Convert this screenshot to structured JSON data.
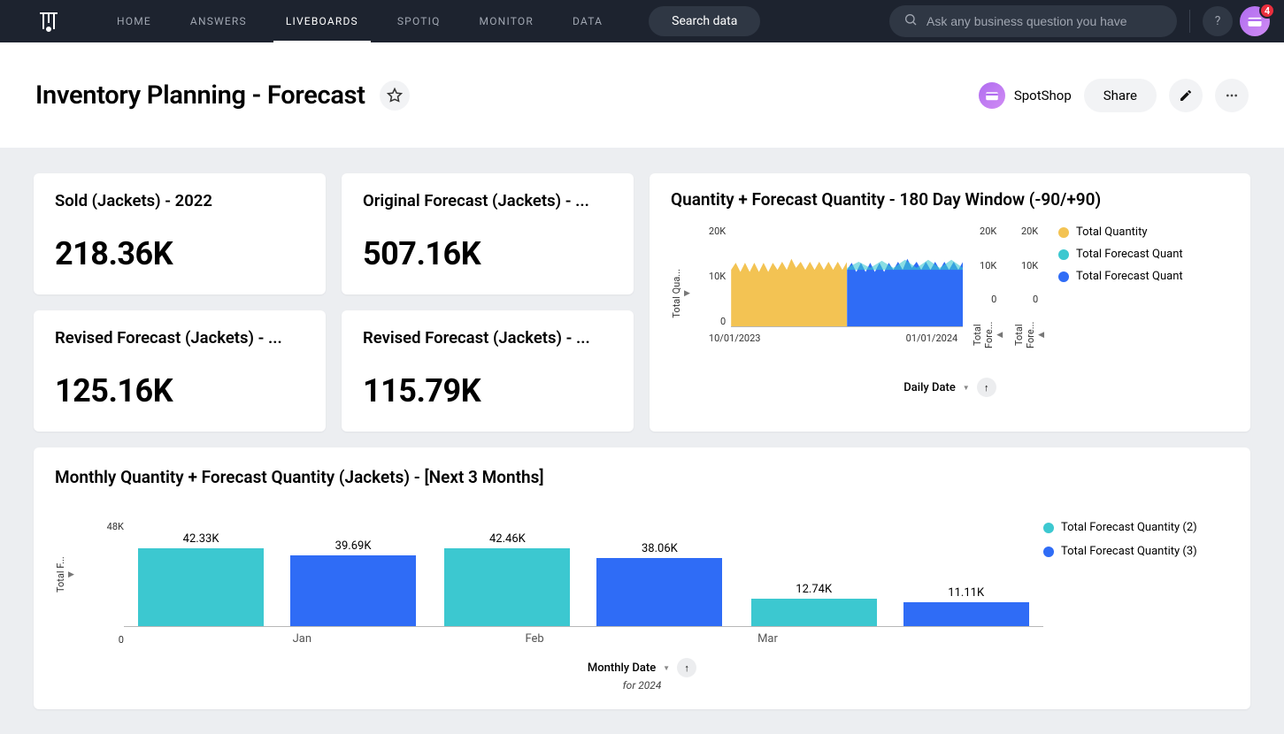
{
  "nav": {
    "items": [
      "HOME",
      "ANSWERS",
      "LIVEBOARDS",
      "SPOTIQ",
      "MONITOR",
      "DATA"
    ],
    "active": 2,
    "search_data": "Search data",
    "ask_placeholder": "Ask any business question you have",
    "help_glyph": "?",
    "notif_count": "4"
  },
  "header": {
    "title": "Inventory Planning - Forecast",
    "owner": "SpotShop",
    "share": "Share"
  },
  "kpis": [
    {
      "title": "Sold (Jackets) - 2022",
      "value": "218.36K"
    },
    {
      "title": "Original Forecast (Jackets) - ...",
      "value": "507.16K"
    },
    {
      "title": "Revised Forecast (Jackets) - ...",
      "value": "125.16K"
    },
    {
      "title": "Revised Forecast (Jackets) - ...",
      "value": "115.79K"
    }
  ],
  "area": {
    "title": "Quantity + Forecast Quantity - 180 Day Window (-90/+90)",
    "ylabel": "Total Qua...",
    "yticks": [
      "20K",
      "10K",
      "0"
    ],
    "yticks2": [
      "20K",
      "10K",
      "0"
    ],
    "y2label": "Total Fore...",
    "yticks3": [
      "20K",
      "10K",
      "0"
    ],
    "y3label": "Total Fore...",
    "xticks": [
      "10/01/2023",
      "01/01/2024"
    ],
    "xaxis": "Daily Date",
    "legend": [
      {
        "label": "Total Quantity",
        "color": "#f3c353"
      },
      {
        "label": "Total Forecast Quant",
        "color": "#3cc8d0"
      },
      {
        "label": "Total Forecast Quant",
        "color": "#2f6cf6"
      }
    ]
  },
  "monthly": {
    "title": "Monthly Quantity + Forecast Quantity (Jackets) - [Next 3 Months]",
    "ylabel": "Total F...",
    "yticks": [
      "48K",
      "0"
    ],
    "categories": [
      "Jan",
      "Feb",
      "Mar"
    ],
    "series": [
      {
        "name": "Total Forecast Quantity (2)",
        "color": "#3cc8d0"
      },
      {
        "name": "Total Forecast Quantity (3)",
        "color": "#2f6cf6"
      }
    ],
    "bars": [
      {
        "t": "42.33K",
        "tpx": 88,
        "b": "39.69K",
        "bpx": 80
      },
      {
        "t": "42.46K",
        "tpx": 88,
        "b": "38.06K",
        "bpx": 77
      },
      {
        "t": "12.74K",
        "tpx": 31,
        "b": "11.11K",
        "bpx": 27
      }
    ],
    "xaxis": "Monthly Date",
    "xsub": "for 2024"
  },
  "chart_data": [
    {
      "type": "area",
      "title": "Quantity + Forecast Quantity - 180 Day Window (-90/+90)",
      "x_range": [
        "2023-10-01",
        "2024-04-01"
      ],
      "xlabel": "Daily Date",
      "y_axes": [
        {
          "label": "Total Quantity",
          "range": [
            0,
            20000
          ]
        },
        {
          "label": "Total Forecast Quantity",
          "range": [
            0,
            20000
          ]
        },
        {
          "label": "Total Forecast Quantity",
          "range": [
            0,
            20000
          ]
        }
      ],
      "series": [
        {
          "name": "Total Quantity",
          "color": "#f3c353",
          "x_span": [
            "2023-10-01",
            "2024-01-01"
          ],
          "approx_level": 11000
        },
        {
          "name": "Total Forecast Quantity",
          "color": "#3cc8d0",
          "x_span": [
            "2024-01-01",
            "2024-04-01"
          ],
          "approx_level": 12000
        },
        {
          "name": "Total Forecast Quantity",
          "color": "#2f6cf6",
          "x_span": [
            "2024-01-01",
            "2024-04-01"
          ],
          "approx_level": 11000
        }
      ]
    },
    {
      "type": "bar",
      "title": "Monthly Quantity + Forecast Quantity (Jackets) - [Next 3 Months]",
      "xlabel": "Monthly Date",
      "xsub": "for 2024",
      "ylabel": "Total Forecast Quantity",
      "ylim": [
        0,
        48000
      ],
      "categories": [
        "Jan",
        "Feb",
        "Mar"
      ],
      "series": [
        {
          "name": "Total Forecast Quantity (2)",
          "color": "#3cc8d0",
          "values": [
            42330,
            42460,
            12740
          ]
        },
        {
          "name": "Total Forecast Quantity (3)",
          "color": "#2f6cf6",
          "values": [
            39690,
            38060,
            11110
          ]
        }
      ]
    }
  ]
}
